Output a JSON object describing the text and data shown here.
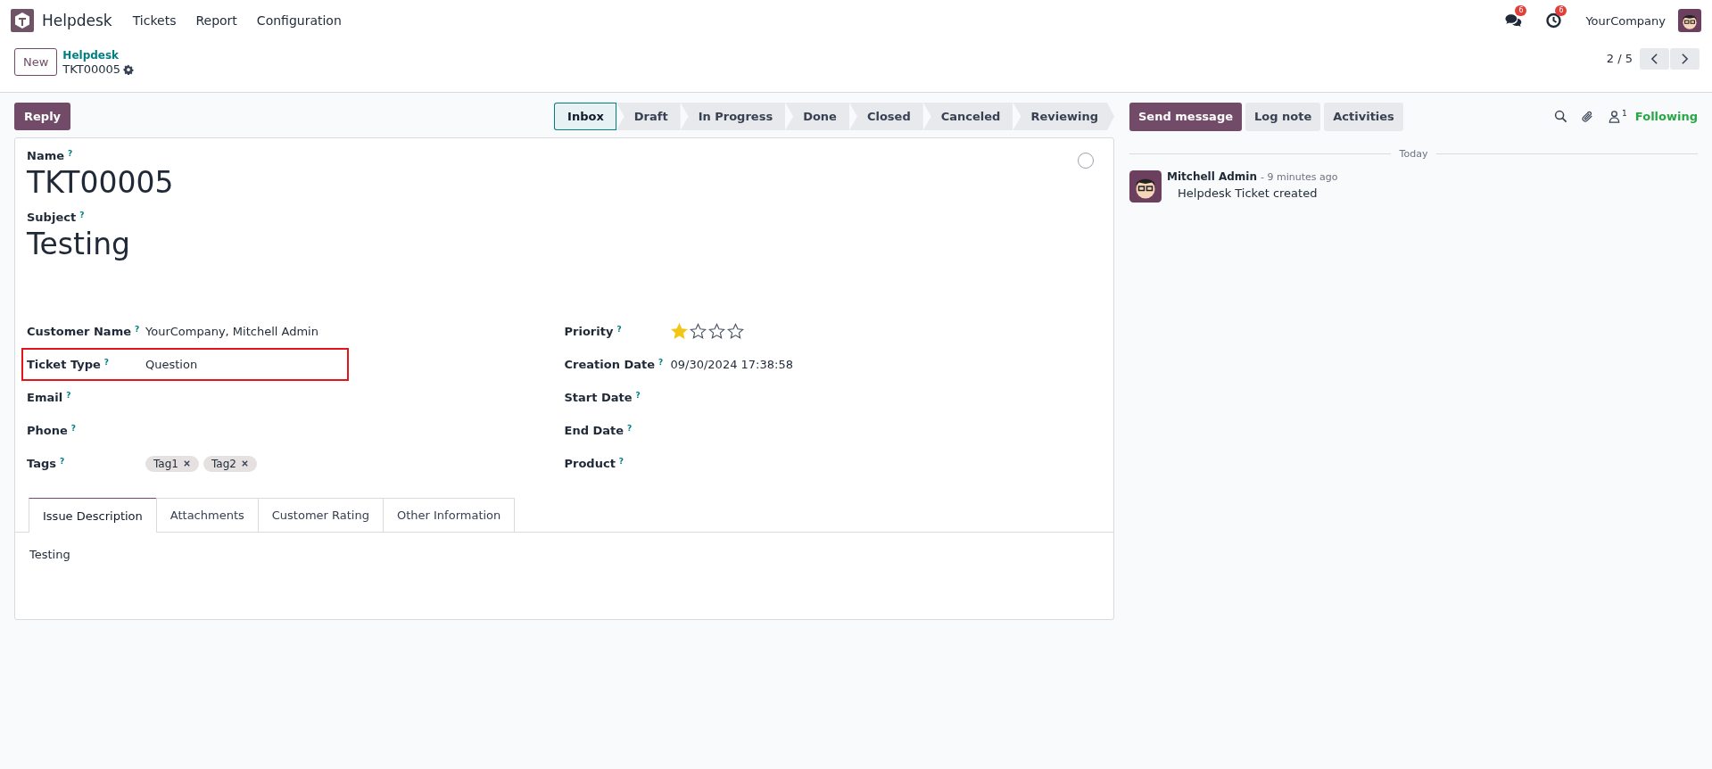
{
  "navbar": {
    "app_name": "Helpdesk",
    "menus": [
      "Tickets",
      "Report",
      "Configuration"
    ],
    "messages_count": "6",
    "activities_count": "6",
    "company": "YourCompany"
  },
  "control_panel": {
    "new_button": "New",
    "breadcrumb": "Helpdesk",
    "record": "TKT00005",
    "pager_value": "2 / 5"
  },
  "action_bar": {
    "reply_button": "Reply",
    "stages": [
      {
        "label": "Inbox",
        "selected": true
      },
      {
        "label": "Draft",
        "selected": false
      },
      {
        "label": "In Progress",
        "selected": false
      },
      {
        "label": "Done",
        "selected": false
      },
      {
        "label": "Closed",
        "selected": false
      },
      {
        "label": "Canceled",
        "selected": false
      },
      {
        "label": "Reviewing",
        "selected": false
      }
    ]
  },
  "form": {
    "name_label": "Name",
    "name_help": "?",
    "name": "TKT00005",
    "subject_label": "Subject",
    "subject_help": "?",
    "subject": "Testing",
    "left_fields": [
      {
        "kind": "text",
        "label": "Customer Name",
        "help": "?",
        "value": "YourCompany, Mitchell Admin",
        "highlighted": false
      },
      {
        "kind": "text",
        "label": "Ticket Type",
        "help": "?",
        "value": "Question",
        "highlighted": true
      },
      {
        "kind": "text",
        "label": "Email",
        "help": "?",
        "highlighted": false
      },
      {
        "kind": "text",
        "label": "Phone",
        "help": "?",
        "highlighted": false
      },
      {
        "kind": "tags",
        "label": "Tags",
        "help": "?",
        "tags": [
          "Tag1",
          "Tag2"
        ],
        "highlighted": false
      }
    ],
    "right_fields": [
      {
        "kind": "priority",
        "label": "Priority",
        "help": "?",
        "stars": 1
      },
      {
        "kind": "text",
        "label": "Creation Date",
        "help": "?",
        "value": "09/30/2024 17:38:58"
      },
      {
        "kind": "text",
        "label": "Start Date",
        "help": "?"
      },
      {
        "kind": "text",
        "label": "End Date",
        "help": "?"
      },
      {
        "kind": "text",
        "label": "Product",
        "help": "?"
      }
    ],
    "tabs": [
      {
        "label": "Issue Description",
        "selected": true
      },
      {
        "label": "Attachments",
        "selected": false
      },
      {
        "label": "Customer Rating",
        "selected": false
      },
      {
        "label": "Other Information",
        "selected": false
      }
    ],
    "tab_content": "Testing"
  },
  "chatter": {
    "buttons": [
      {
        "label": "Send message",
        "selected": true
      },
      {
        "label": "Log note",
        "selected": false
      },
      {
        "label": "Activities",
        "selected": false
      }
    ],
    "followers_count": "1",
    "follow_status": "Following",
    "date_divider": "Today",
    "messages": [
      {
        "author": "Mitchell Admin",
        "time": "- 9 minutes ago",
        "body": "Helpdesk Ticket created"
      }
    ]
  }
}
